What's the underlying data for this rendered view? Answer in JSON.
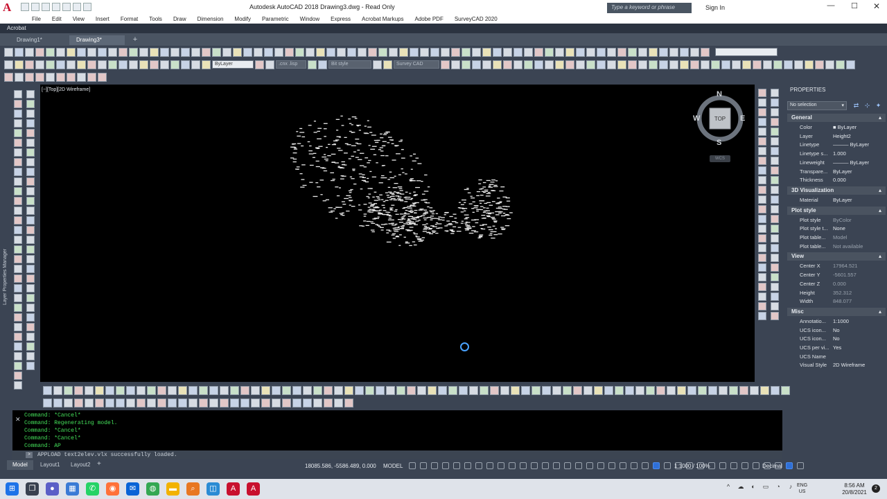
{
  "app": {
    "logo": "A",
    "window_title": "Autodesk AutoCAD 2018     Drawing3.dwg - Read Only",
    "search_placeholder": "Type a keyword or phrase",
    "sign_in": "Sign In",
    "min": "—",
    "max": "☐",
    "close": "✕"
  },
  "menu": [
    "File",
    "Edit",
    "View",
    "Insert",
    "Format",
    "Tools",
    "Draw",
    "Dimension",
    "Modify",
    "Parametric",
    "Window",
    "Express",
    "Acrobat Markups",
    "Adobe PDF",
    "SurveyCAD 2020"
  ],
  "ribbon": {
    "acrobat": "Acrobat"
  },
  "doc_tabs": {
    "tab1": "Drawing1*",
    "tab2": "Drawing3*",
    "add": "+"
  },
  "toolbar": {
    "layer_field": "ByLayer",
    "linetype_field": ".cnx .lisp",
    "field3": "Bit style",
    "field4": "Survey CAD"
  },
  "left_panel": {
    "label": "Layer Properties Manager"
  },
  "viewport": {
    "label": "[−][Top][2D Wireframe]",
    "viewcube": {
      "n": "N",
      "s": "S",
      "e": "E",
      "w": "W",
      "top": "TOP"
    },
    "wcs": "WCS"
  },
  "properties": {
    "title": "PROPERTIES",
    "selection": "No selection",
    "sections": [
      {
        "name": "General",
        "rows": [
          {
            "k": "Color",
            "v": "■ ByLayer"
          },
          {
            "k": "Layer",
            "v": "Height2"
          },
          {
            "k": "Linetype",
            "v": "——— ByLayer"
          },
          {
            "k": "Linetype s...",
            "v": "1.000"
          },
          {
            "k": "Lineweight",
            "v": "——— ByLayer"
          },
          {
            "k": "Transpare...",
            "v": "ByLayer"
          },
          {
            "k": "Thickness",
            "v": "0.000"
          }
        ]
      },
      {
        "name": "3D Visualization",
        "rows": [
          {
            "k": "Material",
            "v": "ByLayer"
          }
        ]
      },
      {
        "name": "Plot style",
        "rows": [
          {
            "k": "Plot style",
            "v": "ByColor"
          },
          {
            "k": "Plot style t...",
            "v": "None"
          },
          {
            "k": "Plot table...",
            "v": "Model"
          },
          {
            "k": "Plot table...",
            "v": "Not available"
          }
        ]
      },
      {
        "name": "View",
        "rows": [
          {
            "k": "Center X",
            "v": "17964.521"
          },
          {
            "k": "Center Y",
            "v": "-5601.557"
          },
          {
            "k": "Center Z",
            "v": "0.000"
          },
          {
            "k": "Height",
            "v": "352.312"
          },
          {
            "k": "Width",
            "v": "848.077"
          }
        ]
      },
      {
        "name": "Misc",
        "rows": [
          {
            "k": "Annotatio...",
            "v": "1:1000"
          },
          {
            "k": "UCS icon...",
            "v": "No"
          },
          {
            "k": "UCS icon...",
            "v": "No"
          },
          {
            "k": "UCS per vi...",
            "v": "Yes"
          },
          {
            "k": "UCS Name",
            "v": ""
          },
          {
            "k": "Visual Style",
            "v": "2D Wireframe"
          }
        ]
      }
    ]
  },
  "command": {
    "close": "✕",
    "history": [
      "Command: *Cancel*",
      "Command:  Regenerating model.",
      "Command: *Cancel*",
      "Command: *Cancel*",
      "Command: AP"
    ],
    "input": "APPLOAD text2elev.vlx successfully loaded."
  },
  "status": {
    "tabs": {
      "model": "Model",
      "layout1": "Layout1",
      "layout2": "Layout2",
      "add": "+"
    },
    "coords": "18085.586, -5586.489, 0.000",
    "model": "MODEL",
    "scale": "1:1000 / 100%",
    "units": "Decimal"
  },
  "taskbar": {
    "lang": [
      "ENG",
      "US"
    ],
    "time": "8:56 AM",
    "date": "20/8/2021",
    "notifications": "2"
  },
  "colors": {
    "canvas": "#000000",
    "panel": "#3b4453",
    "command_text": "#44e05a",
    "accent": "#2f6fd6"
  }
}
